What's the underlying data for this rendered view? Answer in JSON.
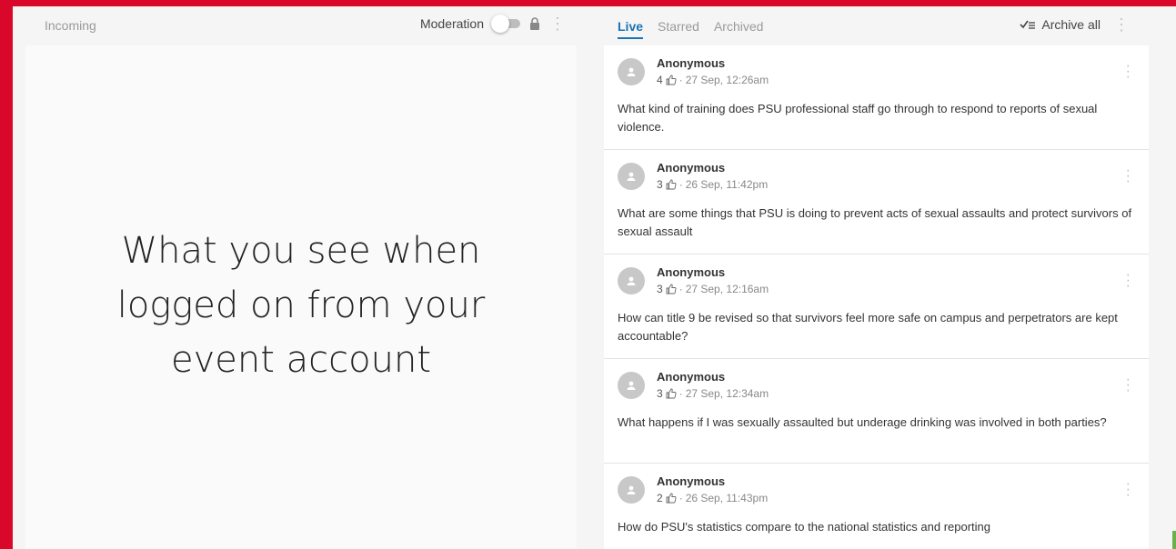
{
  "left": {
    "incoming_label": "Incoming",
    "moderation_label": "Moderation",
    "caption_lines": [
      "What you see when",
      "logged on from your",
      "event account"
    ]
  },
  "right": {
    "tabs": [
      {
        "label": "Live",
        "active": true
      },
      {
        "label": "Starred",
        "active": false
      },
      {
        "label": "Archived",
        "active": false
      }
    ],
    "archive_all_label": "Archive all"
  },
  "questions": [
    {
      "author": "Anonymous",
      "likes": "4",
      "time": "27 Sep, 12:26am",
      "text": "What kind of training does PSU professional staff go through to respond to reports of sexual violence."
    },
    {
      "author": "Anonymous",
      "likes": "3",
      "time": "26 Sep, 11:42pm",
      "text": "What are some things that PSU is doing to prevent acts of sexual assaults and protect survivors of sexual assault"
    },
    {
      "author": "Anonymous",
      "likes": "3",
      "time": "27 Sep, 12:16am",
      "text": "How can title 9 be revised so that survivors feel more safe on campus and perpetrators are kept accountable?"
    },
    {
      "author": "Anonymous",
      "likes": "3",
      "time": "27 Sep, 12:34am",
      "text": "What happens if I was sexually assaulted but underage drinking was involved in both parties?"
    },
    {
      "author": "Anonymous",
      "likes": "2",
      "time": "26 Sep, 11:43pm",
      "text": "How do PSU's statistics compare to the national statistics and reporting"
    }
  ],
  "colors": {
    "frame": "#d9082b",
    "accent": "#1a73b5"
  }
}
